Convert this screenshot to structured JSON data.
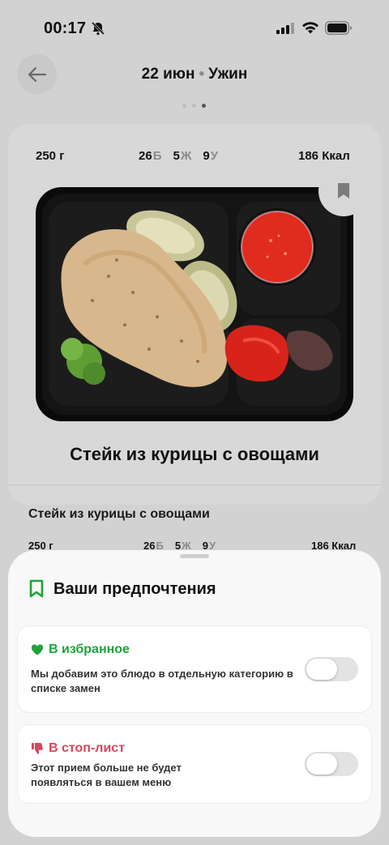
{
  "status_bar": {
    "time": "00:17"
  },
  "header": {
    "date": "22 июн",
    "separator": "•",
    "meal": "Ужин"
  },
  "nutrition": {
    "weight": "250 г",
    "protein_value": "26",
    "protein_label": "Б",
    "fat_value": "5",
    "fat_label": "Ж",
    "carbs_value": "9",
    "carbs_label": "У",
    "kcal": "186 Ккал"
  },
  "dish": {
    "title": "Стейк из курицы с овощами",
    "subtitle": "Стейк из курицы с овощами"
  },
  "sheet": {
    "title": "Ваши предпочтения",
    "favorites": {
      "title": "В избранное",
      "desc_line1": "Мы добавим это блюдо в отдельную категорию в",
      "desc_line2": "списке замен",
      "enabled": false
    },
    "stoplist": {
      "title": "В стоп-лист",
      "desc_line1": "Этот прием больше не будет",
      "desc_line2": "появляться в вашем меню",
      "enabled": false
    }
  },
  "colors": {
    "favorite_green": "#1fa33a",
    "stoplist_red": "#d4475e",
    "bookmark_green": "#1fa33a"
  }
}
